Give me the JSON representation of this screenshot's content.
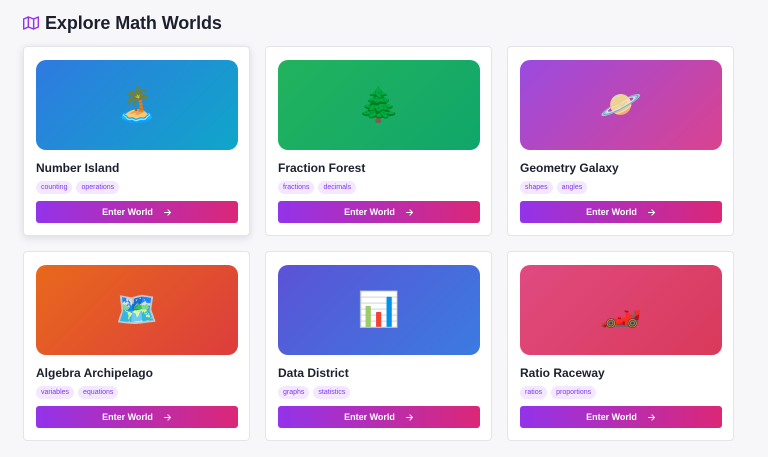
{
  "header": {
    "title": "Explore Math Worlds",
    "icon": "map-icon"
  },
  "colors": {
    "accent": "#9333ea",
    "button_gradient_start": "#9333ea",
    "button_gradient_end": "#db2777",
    "tag_text": "#7c3aed",
    "tag_background": "#f3e8ff"
  },
  "worlds": [
    {
      "title": "Number Island",
      "icon": "desert-island-icon",
      "emoji": "🏝️",
      "gradient": [
        "#2f7ae0",
        "#0fa6c9"
      ],
      "tags": [
        "counting",
        "operations"
      ],
      "button_label": "Enter World"
    },
    {
      "title": "Fraction Forest",
      "icon": "evergreen-tree-icon",
      "emoji": "🌲",
      "gradient": [
        "#22b35e",
        "#10a66a"
      ],
      "tags": [
        "fractions",
        "decimals"
      ],
      "button_label": "Enter World"
    },
    {
      "title": "Geometry Galaxy",
      "icon": "ringed-planet-icon",
      "emoji": "🪐",
      "gradient": [
        "#9b4be0",
        "#d9438f"
      ],
      "tags": [
        "shapes",
        "angles"
      ],
      "button_label": "Enter World"
    },
    {
      "title": "Algebra Archipelago",
      "icon": "world-map-icon",
      "emoji": "🗺️",
      "gradient": [
        "#e8691c",
        "#dc3d3d"
      ],
      "tags": [
        "variables",
        "equations"
      ],
      "button_label": "Enter World"
    },
    {
      "title": "Data District",
      "icon": "bar-chart-icon",
      "emoji": "📊",
      "gradient": [
        "#5b53d6",
        "#3b7be0"
      ],
      "tags": [
        "graphs",
        "statistics"
      ],
      "button_label": "Enter World"
    },
    {
      "title": "Ratio Raceway",
      "icon": "racing-car-icon",
      "emoji": "🏎️",
      "gradient": [
        "#e04a80",
        "#d93a5a"
      ],
      "tags": [
        "ratios",
        "proportions"
      ],
      "button_label": "Enter World"
    }
  ]
}
